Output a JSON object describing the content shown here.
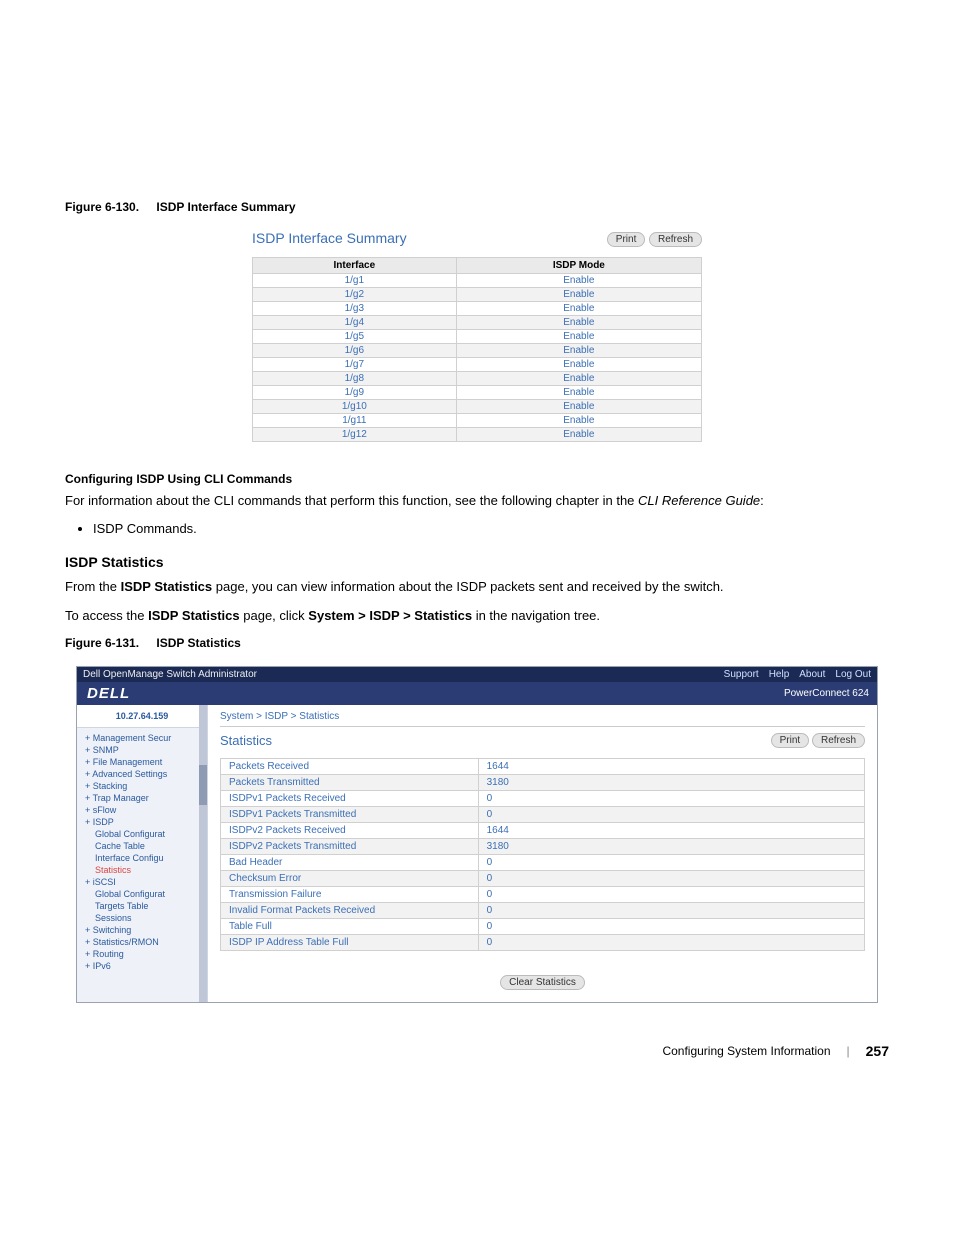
{
  "captions": {
    "fig130_label": "Figure 6-130.",
    "fig130_title": "ISDP Interface Summary",
    "fig131_label": "Figure 6-131.",
    "fig131_title": "ISDP Statistics"
  },
  "fig130": {
    "title": "ISDP Interface Summary",
    "print_btn": "Print",
    "refresh_btn": "Refresh",
    "header_interface": "Interface",
    "header_mode": "ISDP Mode",
    "rows": [
      {
        "iface": "1/g1",
        "mode": "Enable"
      },
      {
        "iface": "1/g2",
        "mode": "Enable"
      },
      {
        "iface": "1/g3",
        "mode": "Enable"
      },
      {
        "iface": "1/g4",
        "mode": "Enable"
      },
      {
        "iface": "1/g5",
        "mode": "Enable"
      },
      {
        "iface": "1/g6",
        "mode": "Enable"
      },
      {
        "iface": "1/g7",
        "mode": "Enable"
      },
      {
        "iface": "1/g8",
        "mode": "Enable"
      },
      {
        "iface": "1/g9",
        "mode": "Enable"
      },
      {
        "iface": "1/g10",
        "mode": "Enable"
      },
      {
        "iface": "1/g11",
        "mode": "Enable"
      },
      {
        "iface": "1/g12",
        "mode": "Enable"
      }
    ]
  },
  "body": {
    "cli_head": "Configuring ISDP Using CLI Commands",
    "cli_text_1": "For information about the CLI commands that perform this function, see the following chapter in the ",
    "cli_text_guide": "CLI Reference Guide",
    "cli_text_2": ":",
    "cli_bullet_1": "ISDP Commands.",
    "stats_head": "ISDP Statistics",
    "stats_p1_a": "From the ",
    "stats_p1_b": "ISDP Statistics",
    "stats_p1_c": " page, you can view information about the ISDP packets sent and received by the switch.",
    "stats_p2_a": "To access the ",
    "stats_p2_b": "ISDP Statistics",
    "stats_p2_c": " page, click ",
    "stats_p2_d": "System > ISDP > Statistics",
    "stats_p2_e": " in the navigation tree."
  },
  "fig131": {
    "topbar_title": "Dell OpenManage Switch Administrator",
    "topbar_links": [
      "Support",
      "Help",
      "About",
      "Log Out"
    ],
    "logo": "DELL",
    "product": "PowerConnect 624",
    "ip": "10.27.64.159",
    "sidebar": [
      {
        "text": "Management Secur",
        "level": 1
      },
      {
        "text": "SNMP",
        "level": 1
      },
      {
        "text": "File Management",
        "level": 1
      },
      {
        "text": "Advanced Settings",
        "level": 1
      },
      {
        "text": "Stacking",
        "level": 1
      },
      {
        "text": "Trap Manager",
        "level": 1
      },
      {
        "text": "sFlow",
        "level": 1
      },
      {
        "text": "ISDP",
        "level": 1
      },
      {
        "text": "Global Configurat",
        "level": 2
      },
      {
        "text": "Cache Table",
        "level": 2
      },
      {
        "text": "Interface Configu",
        "level": 2
      },
      {
        "text": "Statistics",
        "level": 2,
        "active": true
      },
      {
        "text": "iSCSI",
        "level": 1
      },
      {
        "text": "Global Configurat",
        "level": 2
      },
      {
        "text": "Targets Table",
        "level": 2
      },
      {
        "text": "Sessions",
        "level": 2
      },
      {
        "text": "Switching",
        "level": 1
      },
      {
        "text": "Statistics/RMON",
        "level": 1
      },
      {
        "text": "Routing",
        "level": 1
      },
      {
        "text": "IPv6",
        "level": 1
      }
    ],
    "breadcrumb": "System > ISDP > Statistics",
    "panel_title": "Statistics",
    "print_btn": "Print",
    "refresh_btn": "Refresh",
    "stats": [
      {
        "label": "Packets Received",
        "value": "1644"
      },
      {
        "label": "Packets Transmitted",
        "value": "3180"
      },
      {
        "label": "ISDPv1 Packets Received",
        "value": "0"
      },
      {
        "label": "ISDPv1 Packets Transmitted",
        "value": "0"
      },
      {
        "label": "ISDPv2 Packets Received",
        "value": "1644"
      },
      {
        "label": "ISDPv2 Packets Transmitted",
        "value": "3180"
      },
      {
        "label": "Bad Header",
        "value": "0"
      },
      {
        "label": "Checksum Error",
        "value": "0"
      },
      {
        "label": "Transmission Failure",
        "value": "0"
      },
      {
        "label": "Invalid Format Packets Received",
        "value": "0"
      },
      {
        "label": "Table Full",
        "value": "0"
      },
      {
        "label": "ISDP IP Address Table Full",
        "value": "0"
      }
    ],
    "clear_btn": "Clear Statistics"
  },
  "footer": {
    "label": "Configuring System Information",
    "page": "257"
  }
}
